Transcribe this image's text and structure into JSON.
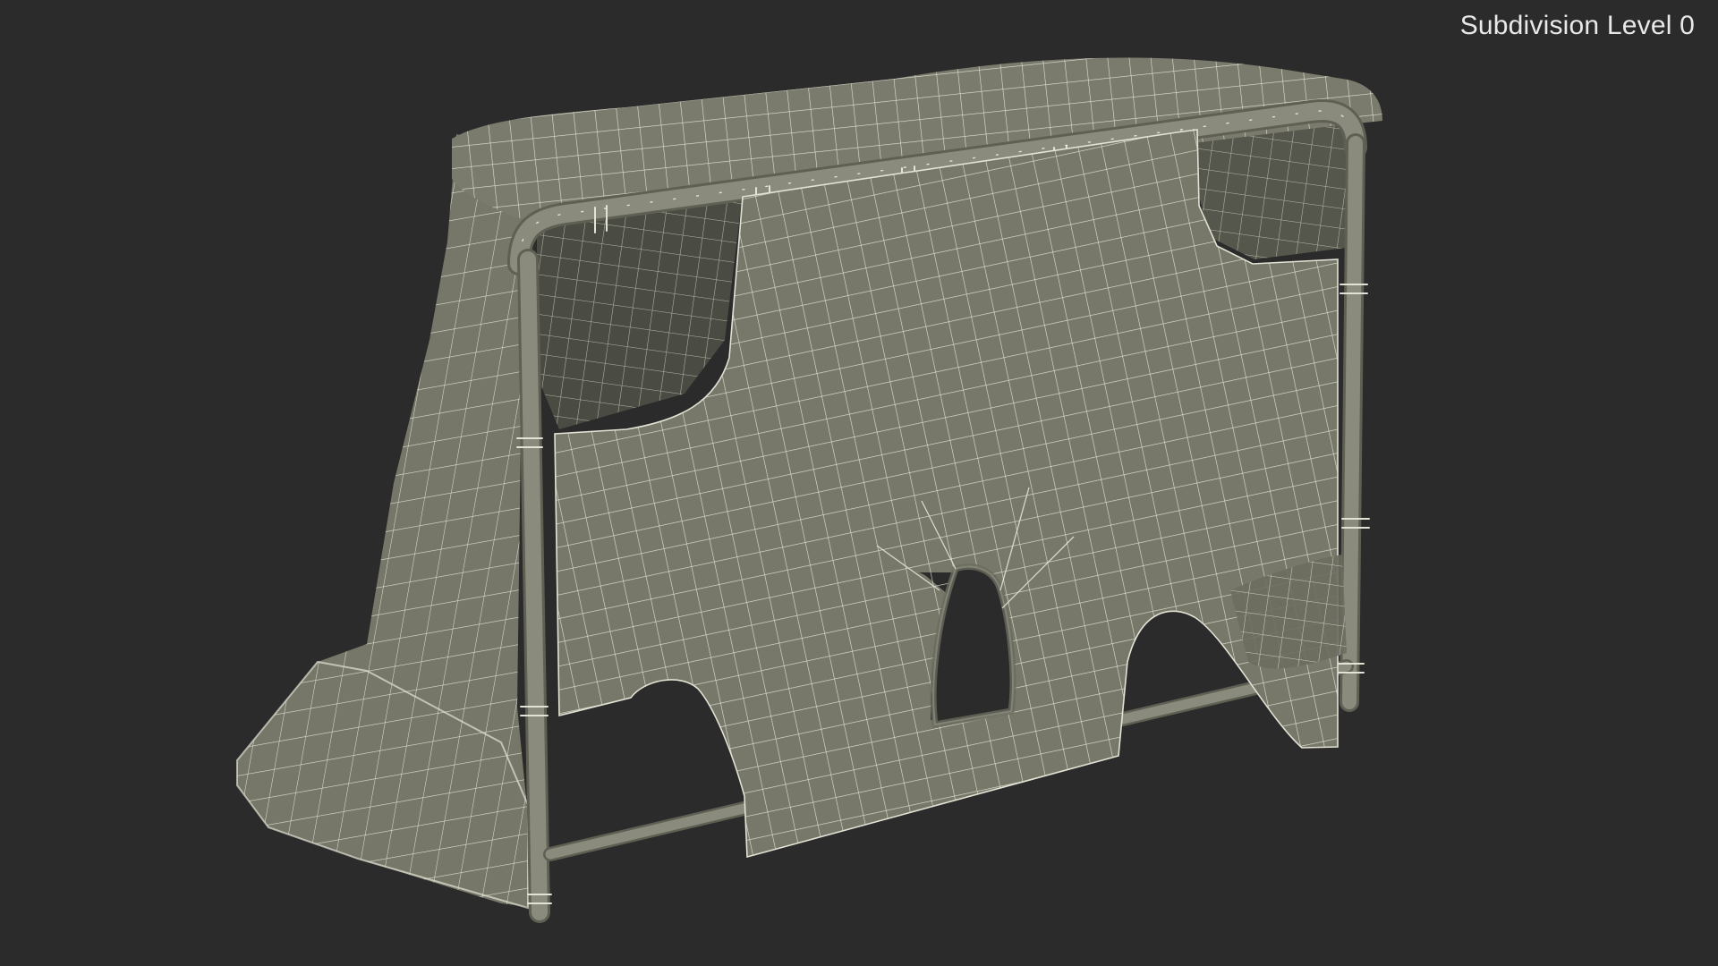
{
  "viewport": {
    "background": "#2b2b2b",
    "subdivision_label": "Subdivision Level 0"
  },
  "model": {
    "subject": "hockey-goal-wireframe",
    "surface_color": "#777869",
    "frame_color": "#848577",
    "wire_color": "#e2e2d5",
    "shadow_color": "#4a4b42"
  }
}
